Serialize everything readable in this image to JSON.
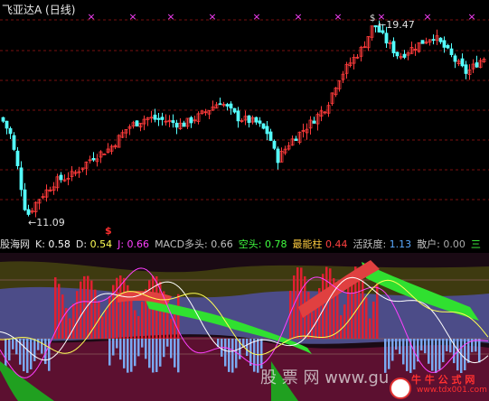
{
  "header": {
    "stock_name": "飞亚达A",
    "period": "(日线)"
  },
  "price_chart": {
    "high_label": "19.47",
    "low_label": "11.09",
    "signal_mark": "$",
    "top_mark": "×",
    "colors": {
      "up": "#ff3b3b",
      "down": "#54ffff",
      "grid": "#7a1010",
      "mark": "#ff40ff"
    }
  },
  "indicator_bar": {
    "name": "股海网",
    "items": [
      {
        "label": "K:",
        "value": "0.58",
        "color": "#ffffff"
      },
      {
        "label": "D:",
        "value": "0.54",
        "color": "#ffff55"
      },
      {
        "label": "J:",
        "value": "0.66",
        "color": "#ff40ff"
      },
      {
        "label": "MACD多头:",
        "value": "0.66",
        "color": "#c0c0c0"
      },
      {
        "label": "空头:",
        "value": "0.78",
        "color": "#40ff40"
      },
      {
        "label": "最能柱",
        "value": "0.44",
        "color": "#ff4040"
      },
      {
        "label": "活跃度:",
        "value": "1.13",
        "color": "#5aaaff"
      },
      {
        "label": "散户:",
        "value": "0.00",
        "color": "#aaaaaa"
      },
      {
        "label": "",
        "value": "三",
        "color": "#40ff40"
      }
    ]
  },
  "watermarks": {
    "main": "股  票  网   www.gu",
    "site": "牛 牛 公 式 网",
    "url": "www.tdx001.com"
  },
  "chart_data": {
    "type": "candlestick",
    "y_high": 19.47,
    "y_low": 11.09
  }
}
